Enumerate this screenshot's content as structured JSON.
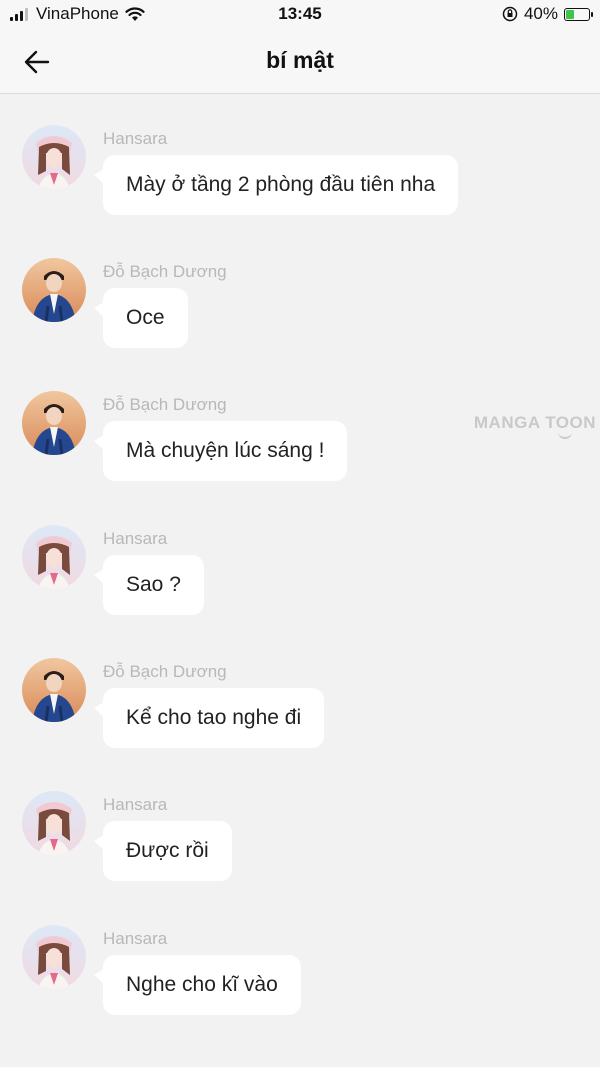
{
  "status_bar": {
    "carrier": "VinaPhone",
    "time": "13:45",
    "battery_percent": "40%",
    "battery_level": 0.4,
    "battery_color": "#3ec64a"
  },
  "header": {
    "title": "bí mật",
    "back_icon": "arrow-left-icon"
  },
  "watermark": "MANGA TOON",
  "messages": [
    {
      "sender": "Hansara",
      "text": "Mày ở tầng 2 phòng đầu tiên nha",
      "avatar": "girl-avatar"
    },
    {
      "sender": "Đỗ Bạch Dương",
      "text": "Oce",
      "avatar": "boy-avatar"
    },
    {
      "sender": "Đỗ Bạch Dương",
      "text": "Mà chuyện lúc sáng !",
      "avatar": "boy-avatar"
    },
    {
      "sender": "Hansara",
      "text": "Sao ?",
      "avatar": "girl-avatar"
    },
    {
      "sender": "Đỗ Bạch Dương",
      "text": "Kể cho tao nghe đi",
      "avatar": "boy-avatar"
    },
    {
      "sender": "Hansara",
      "text": "Được rồi",
      "avatar": "girl-avatar"
    },
    {
      "sender": "Hansara",
      "text": "Nghe cho kĩ vào",
      "avatar": "girl-avatar"
    }
  ],
  "colors": {
    "background": "#f2f2f2",
    "bubble": "#ffffff",
    "sender_name": "#b8b8b8"
  }
}
